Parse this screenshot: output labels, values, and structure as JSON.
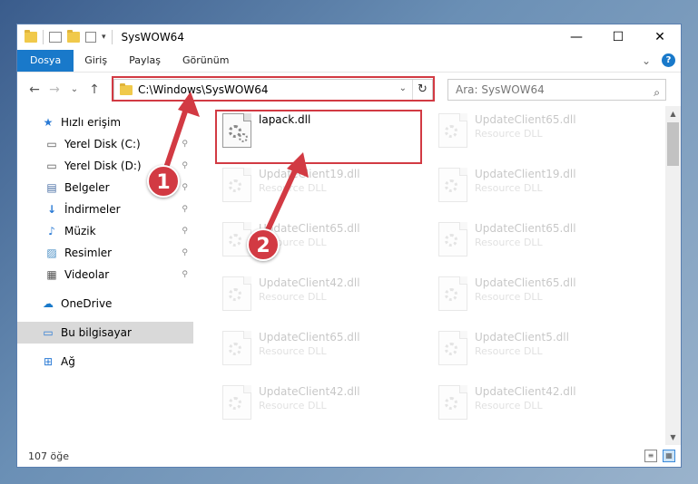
{
  "window": {
    "title": "SysWOW64",
    "controls": {
      "minimize": "—",
      "maximize": "☐",
      "close": "✕"
    }
  },
  "ribbon": {
    "tabs": [
      "Dosya",
      "Giriş",
      "Paylaş",
      "Görünüm"
    ],
    "help": "?",
    "chevron": "⌄"
  },
  "navigation": {
    "back": "←",
    "forward": "→",
    "recent": "⌄",
    "up": "↑",
    "address": "C:\\Windows\\SysWOW64",
    "address_dropdown": "⌄",
    "refresh": "↻",
    "search_placeholder": "Ara: SysWOW64",
    "search_icon": "⌕"
  },
  "sidebar": {
    "items": [
      {
        "label": "Hızlı erişim",
        "icon": "★",
        "pinned": false
      },
      {
        "label": "Yerel Disk (C:)",
        "icon": "▭",
        "pinned": true
      },
      {
        "label": "Yerel Disk (D:)",
        "icon": "▭",
        "pinned": true
      },
      {
        "label": "Belgeler",
        "icon": "▤",
        "pinned": true
      },
      {
        "label": "İndirmeler",
        "icon": "↓",
        "pinned": true
      },
      {
        "label": "Müzik",
        "icon": "♪",
        "pinned": true
      },
      {
        "label": "Resimler",
        "icon": "▨",
        "pinned": true
      },
      {
        "label": "Videolar",
        "icon": "▦",
        "pinned": true
      },
      {
        "label": "OneDrive",
        "icon": "☁",
        "pinned": false
      },
      {
        "label": "Bu bilgisayar",
        "icon": "▭",
        "pinned": false
      },
      {
        "label": "Ağ",
        "icon": "⊞",
        "pinned": false
      }
    ],
    "pin_glyph": "⚲"
  },
  "files": [
    {
      "name": "lapack.dll",
      "type": ""
    },
    {
      "name": "UpdateClient65.dll",
      "type": "Resource DLL"
    },
    {
      "name": "UpdateClient19.dll",
      "type": "Resource DLL"
    },
    {
      "name": "UpdateClient19.dll",
      "type": "Resource DLL"
    },
    {
      "name": "UpdateClient65.dll",
      "type": "Resource DLL"
    },
    {
      "name": "UpdateClient65.dll",
      "type": "Resource DLL"
    },
    {
      "name": "UpdateClient42.dll",
      "type": "Resource DLL"
    },
    {
      "name": "UpdateClient65.dll",
      "type": "Resource DLL"
    },
    {
      "name": "UpdateClient65.dll",
      "type": "Resource DLL"
    },
    {
      "name": "UpdateClient5.dll",
      "type": "Resource DLL"
    },
    {
      "name": "UpdateClient42.dll",
      "type": "Resource DLL"
    },
    {
      "name": "UpdateClient42.dll",
      "type": "Resource DLL"
    }
  ],
  "status": {
    "count": "107 öğe"
  },
  "annotations": {
    "badge_1": "1",
    "badge_2": "2",
    "color": "#d23a43"
  },
  "colors": {
    "accent": "#1979ca",
    "highlight": "#d23a43"
  }
}
